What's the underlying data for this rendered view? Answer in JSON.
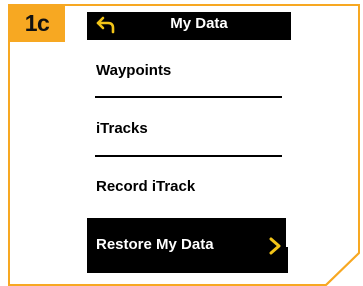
{
  "step_badge": "1c",
  "header": {
    "title": "My Data",
    "back_icon": "back-arrow-icon"
  },
  "menu": {
    "items": [
      {
        "label": "Waypoints"
      },
      {
        "label": "iTracks"
      },
      {
        "label": "Record iTrack"
      }
    ],
    "selected": {
      "label": "Restore My Data",
      "icon": "chevron-right-icon"
    }
  },
  "colors": {
    "badge": "#f7a822",
    "frame": "#f7a822",
    "title_bar": "#000000",
    "selected_bg": "#000000",
    "chevron": "#f2c418"
  }
}
